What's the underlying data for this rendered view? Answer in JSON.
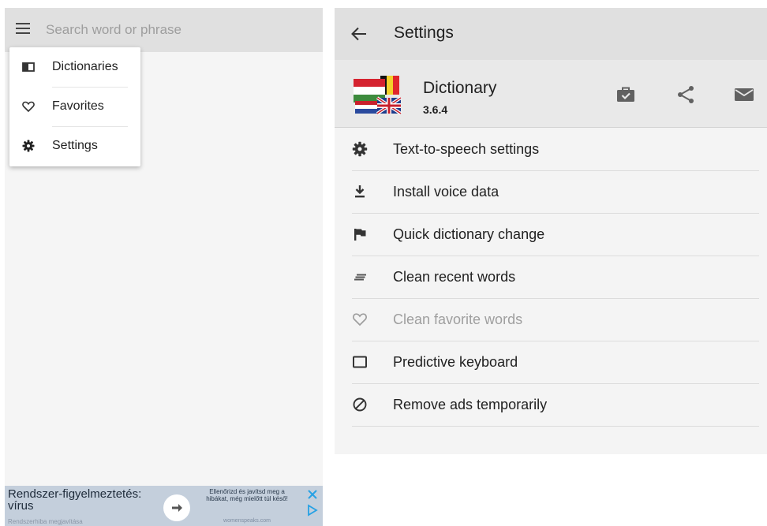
{
  "left_panel": {
    "search": {
      "placeholder": "Search word or phrase",
      "value": ""
    },
    "menu_icon": "hamburger-menu-icon",
    "dropdown": [
      {
        "label": "Dictionaries",
        "icon": "book-icon"
      },
      {
        "label": "Favorites",
        "icon": "heart-outline-icon"
      },
      {
        "label": "Settings",
        "icon": "gear-icon"
      }
    ],
    "ad": {
      "title": "Rendszer-figyelmeztetés: vírus",
      "subtitle": "Rendszerhiba megjavítása",
      "description": "Ellenőrizd és javítsd meg a hibákat, még mielőtt túl késő!",
      "domain": "womenspeaks.com",
      "icons": [
        "arrow-right-icon",
        "close-icon",
        "ad-choices-icon"
      ]
    }
  },
  "right_panel": {
    "toolbar": {
      "title": "Settings",
      "back_icon": "arrow-back-icon"
    },
    "app": {
      "name": "Dictionary",
      "version": "3.6.4",
      "logo": "flags-logo",
      "actions": [
        "briefcase-check-icon",
        "share-icon",
        "mail-icon"
      ]
    },
    "settings": [
      {
        "label": "Text-to-speech settings",
        "icon": "gear-icon",
        "enabled": true
      },
      {
        "label": "Install voice data",
        "icon": "download-icon",
        "enabled": true
      },
      {
        "label": "Quick dictionary change",
        "icon": "flag-icon",
        "enabled": true
      },
      {
        "label": "Clean recent words",
        "icon": "recent-lines-icon",
        "enabled": true
      },
      {
        "label": "Clean favorite words",
        "icon": "heart-outline-icon",
        "enabled": false
      },
      {
        "label": "Predictive keyboard",
        "icon": "keyboard-box-icon",
        "enabled": true
      },
      {
        "label": "Remove ads temporarily",
        "icon": "block-icon",
        "enabled": true
      }
    ]
  },
  "colors": {
    "toolbar_bg": "#e0e0e0",
    "screen_bg": "#f5f5f5",
    "text_primary": "#212121",
    "text_disabled": "#9e9e9e",
    "icon_dark": "#444444",
    "ad_bg": "#c4cfdc",
    "ad_accent": "#26a1e4"
  }
}
